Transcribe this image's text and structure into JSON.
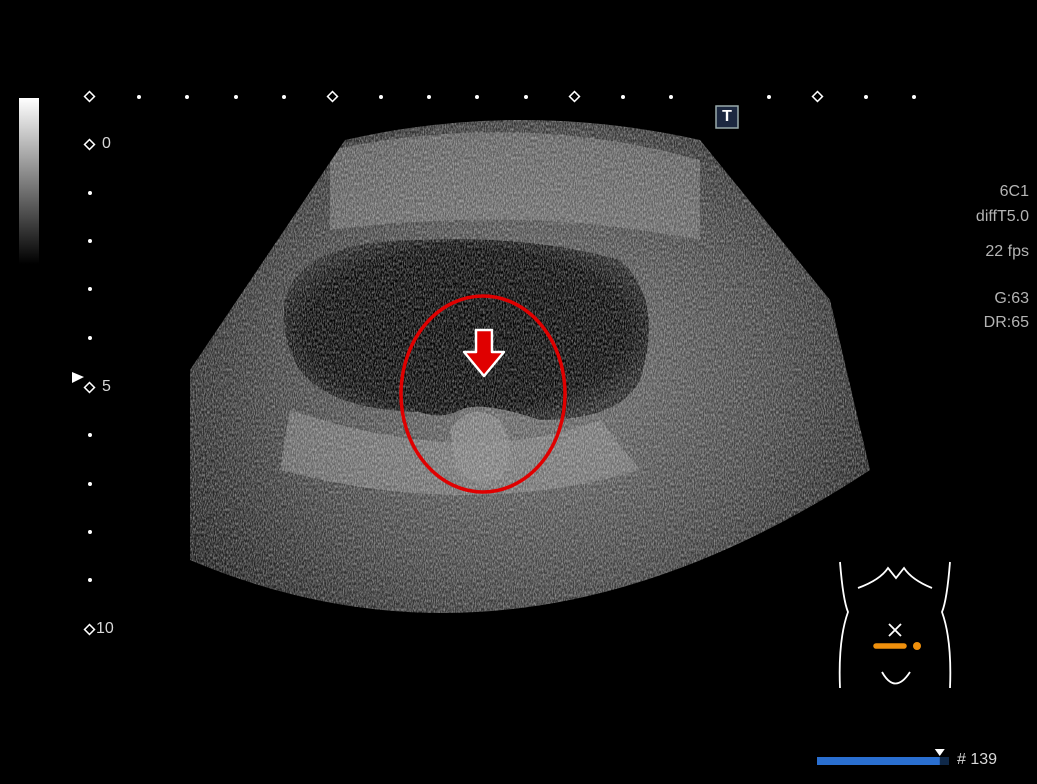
{
  "probe": "6C1",
  "preset": "diffT5.0",
  "frame_rate": "22 fps",
  "gain": "G:63",
  "dynamic_range": "DR:65",
  "depth_scale": {
    "ticks": [
      "0",
      "5",
      "10"
    ]
  },
  "frame": {
    "number": "# 139",
    "progress": 0.93
  },
  "top_marker": "T",
  "colors": {
    "annotation": "#e00000",
    "probe_marker": "#f0900c",
    "frame_bar": "#2a6fd0"
  },
  "icons": [
    "greyscale-bar",
    "focus-triangle",
    "arrow-down-icon",
    "body-pictogram-icon",
    "transducer-marker-icon"
  ]
}
